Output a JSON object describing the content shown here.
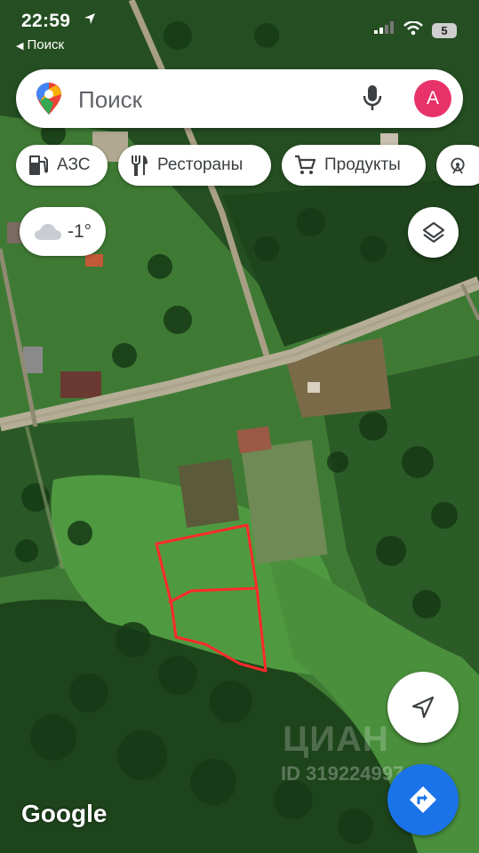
{
  "status_bar": {
    "time": "22:59",
    "back_label": "Поиск",
    "battery": "5"
  },
  "search": {
    "placeholder": "Поиск",
    "avatar_letter": "А"
  },
  "chips": [
    {
      "label": "АЗС",
      "icon": "gas-station-icon"
    },
    {
      "label": "Рестораны",
      "icon": "restaurant-icon"
    },
    {
      "label": "Продукты",
      "icon": "cart-icon"
    }
  ],
  "weather": {
    "temperature": "-1°",
    "icon": "cloud-icon"
  },
  "map": {
    "attribution": "Google",
    "watermark_logo": "ЦИАН",
    "watermark_id": "ID 319224997"
  },
  "colors": {
    "accent": "#1a73e8",
    "avatar": "#e8336a",
    "parcel_outline": "#ff2a2a"
  }
}
